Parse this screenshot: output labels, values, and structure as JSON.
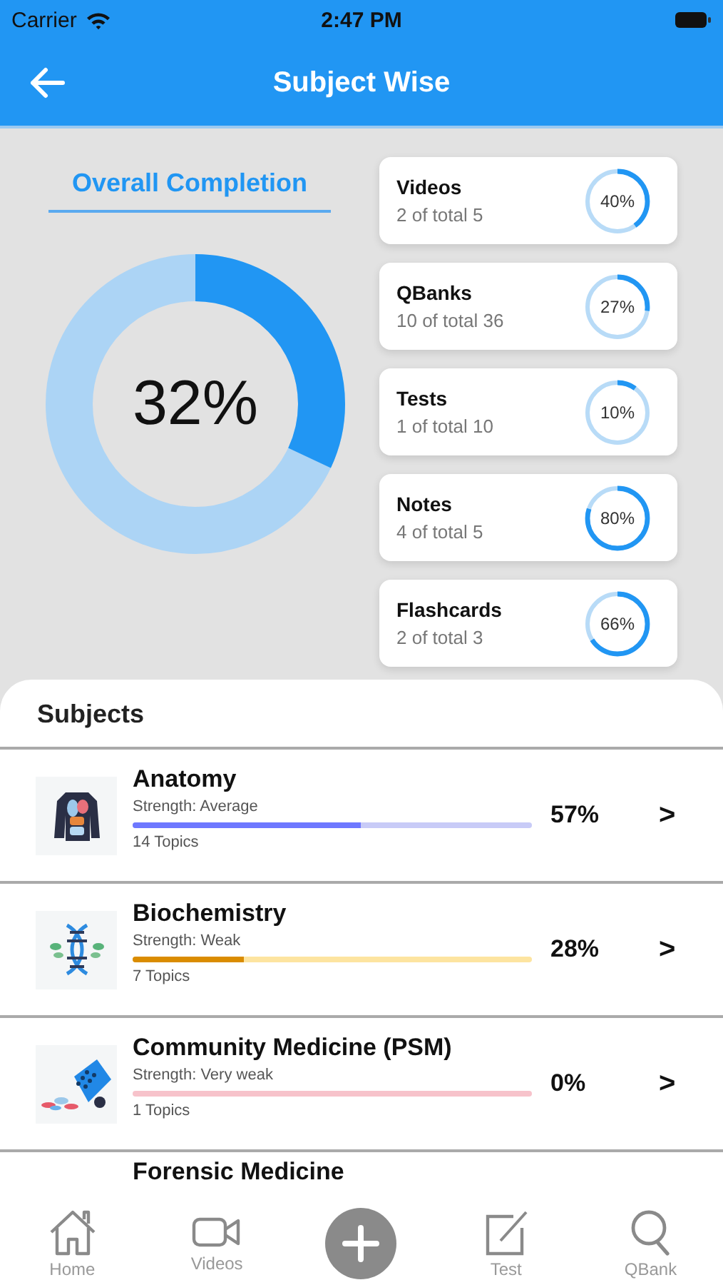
{
  "status_bar": {
    "carrier": "Carrier",
    "time": "2:47 PM"
  },
  "header": {
    "title": "Subject Wise"
  },
  "overall": {
    "title": "Overall Completion",
    "level": 0.32,
    "reading": "32%"
  },
  "categories": [
    {
      "name": "Videos",
      "detail": "2 of total 5",
      "level": 0.4,
      "reading": "40%"
    },
    {
      "name": "QBanks",
      "detail": "10 of total 36",
      "level": 0.27,
      "reading": "27%"
    },
    {
      "name": "Tests",
      "detail": "1 of total 10",
      "level": 0.1,
      "reading": "10%"
    },
    {
      "name": "Notes",
      "detail": "4 of total 5",
      "level": 0.8,
      "reading": "80%"
    },
    {
      "name": "Flashcards",
      "detail": "2 of total 3",
      "level": 0.66,
      "reading": "66%"
    }
  ],
  "subjects": {
    "title": "Subjects",
    "items": [
      {
        "name": "Anatomy",
        "kind": "torso",
        "strength": "Strength: Average",
        "topics": "14 Topics",
        "level": 0.57,
        "color": "#c8cbf7",
        "reading": "57%",
        "chevron": ">"
      },
      {
        "name": "Biochemistry",
        "kind": "dna",
        "strength": "Strength: Weak",
        "topics": "7 Topics",
        "level": 0.28,
        "color": "#fde4a0",
        "reading": "28%",
        "chevron": ">"
      },
      {
        "name": "Community Medicine (PSM)",
        "kind": "pills",
        "strength": "Strength: Very weak",
        "topics": "1 Topics",
        "color": "#f7c3cb",
        "reading": "0%",
        "chevron": ">"
      },
      {
        "name": "Forensic Medicine",
        "kind": "partial"
      }
    ]
  },
  "tab_bar": [
    {
      "kind": "home",
      "label": "Home"
    },
    {
      "kind": "video",
      "label": "Videos"
    },
    {
      "kind": "add"
    },
    {
      "kind": "test",
      "label": "Test"
    },
    {
      "kind": "search",
      "label": "QBank"
    }
  ]
}
